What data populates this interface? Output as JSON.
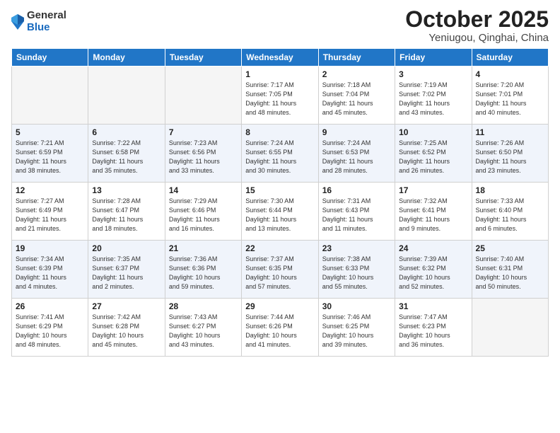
{
  "logo": {
    "general": "General",
    "blue": "Blue"
  },
  "title": {
    "month": "October 2025",
    "location": "Yeniugou, Qinghai, China"
  },
  "weekdays": [
    "Sunday",
    "Monday",
    "Tuesday",
    "Wednesday",
    "Thursday",
    "Friday",
    "Saturday"
  ],
  "weeks": [
    [
      {
        "day": "",
        "info": ""
      },
      {
        "day": "",
        "info": ""
      },
      {
        "day": "",
        "info": ""
      },
      {
        "day": "1",
        "info": "Sunrise: 7:17 AM\nSunset: 7:05 PM\nDaylight: 11 hours\nand 48 minutes."
      },
      {
        "day": "2",
        "info": "Sunrise: 7:18 AM\nSunset: 7:04 PM\nDaylight: 11 hours\nand 45 minutes."
      },
      {
        "day": "3",
        "info": "Sunrise: 7:19 AM\nSunset: 7:02 PM\nDaylight: 11 hours\nand 43 minutes."
      },
      {
        "day": "4",
        "info": "Sunrise: 7:20 AM\nSunset: 7:01 PM\nDaylight: 11 hours\nand 40 minutes."
      }
    ],
    [
      {
        "day": "5",
        "info": "Sunrise: 7:21 AM\nSunset: 6:59 PM\nDaylight: 11 hours\nand 38 minutes."
      },
      {
        "day": "6",
        "info": "Sunrise: 7:22 AM\nSunset: 6:58 PM\nDaylight: 11 hours\nand 35 minutes."
      },
      {
        "day": "7",
        "info": "Sunrise: 7:23 AM\nSunset: 6:56 PM\nDaylight: 11 hours\nand 33 minutes."
      },
      {
        "day": "8",
        "info": "Sunrise: 7:24 AM\nSunset: 6:55 PM\nDaylight: 11 hours\nand 30 minutes."
      },
      {
        "day": "9",
        "info": "Sunrise: 7:24 AM\nSunset: 6:53 PM\nDaylight: 11 hours\nand 28 minutes."
      },
      {
        "day": "10",
        "info": "Sunrise: 7:25 AM\nSunset: 6:52 PM\nDaylight: 11 hours\nand 26 minutes."
      },
      {
        "day": "11",
        "info": "Sunrise: 7:26 AM\nSunset: 6:50 PM\nDaylight: 11 hours\nand 23 minutes."
      }
    ],
    [
      {
        "day": "12",
        "info": "Sunrise: 7:27 AM\nSunset: 6:49 PM\nDaylight: 11 hours\nand 21 minutes."
      },
      {
        "day": "13",
        "info": "Sunrise: 7:28 AM\nSunset: 6:47 PM\nDaylight: 11 hours\nand 18 minutes."
      },
      {
        "day": "14",
        "info": "Sunrise: 7:29 AM\nSunset: 6:46 PM\nDaylight: 11 hours\nand 16 minutes."
      },
      {
        "day": "15",
        "info": "Sunrise: 7:30 AM\nSunset: 6:44 PM\nDaylight: 11 hours\nand 13 minutes."
      },
      {
        "day": "16",
        "info": "Sunrise: 7:31 AM\nSunset: 6:43 PM\nDaylight: 11 hours\nand 11 minutes."
      },
      {
        "day": "17",
        "info": "Sunrise: 7:32 AM\nSunset: 6:41 PM\nDaylight: 11 hours\nand 9 minutes."
      },
      {
        "day": "18",
        "info": "Sunrise: 7:33 AM\nSunset: 6:40 PM\nDaylight: 11 hours\nand 6 minutes."
      }
    ],
    [
      {
        "day": "19",
        "info": "Sunrise: 7:34 AM\nSunset: 6:39 PM\nDaylight: 11 hours\nand 4 minutes."
      },
      {
        "day": "20",
        "info": "Sunrise: 7:35 AM\nSunset: 6:37 PM\nDaylight: 11 hours\nand 2 minutes."
      },
      {
        "day": "21",
        "info": "Sunrise: 7:36 AM\nSunset: 6:36 PM\nDaylight: 10 hours\nand 59 minutes."
      },
      {
        "day": "22",
        "info": "Sunrise: 7:37 AM\nSunset: 6:35 PM\nDaylight: 10 hours\nand 57 minutes."
      },
      {
        "day": "23",
        "info": "Sunrise: 7:38 AM\nSunset: 6:33 PM\nDaylight: 10 hours\nand 55 minutes."
      },
      {
        "day": "24",
        "info": "Sunrise: 7:39 AM\nSunset: 6:32 PM\nDaylight: 10 hours\nand 52 minutes."
      },
      {
        "day": "25",
        "info": "Sunrise: 7:40 AM\nSunset: 6:31 PM\nDaylight: 10 hours\nand 50 minutes."
      }
    ],
    [
      {
        "day": "26",
        "info": "Sunrise: 7:41 AM\nSunset: 6:29 PM\nDaylight: 10 hours\nand 48 minutes."
      },
      {
        "day": "27",
        "info": "Sunrise: 7:42 AM\nSunset: 6:28 PM\nDaylight: 10 hours\nand 45 minutes."
      },
      {
        "day": "28",
        "info": "Sunrise: 7:43 AM\nSunset: 6:27 PM\nDaylight: 10 hours\nand 43 minutes."
      },
      {
        "day": "29",
        "info": "Sunrise: 7:44 AM\nSunset: 6:26 PM\nDaylight: 10 hours\nand 41 minutes."
      },
      {
        "day": "30",
        "info": "Sunrise: 7:46 AM\nSunset: 6:25 PM\nDaylight: 10 hours\nand 39 minutes."
      },
      {
        "day": "31",
        "info": "Sunrise: 7:47 AM\nSunset: 6:23 PM\nDaylight: 10 hours\nand 36 minutes."
      },
      {
        "day": "",
        "info": ""
      }
    ]
  ]
}
